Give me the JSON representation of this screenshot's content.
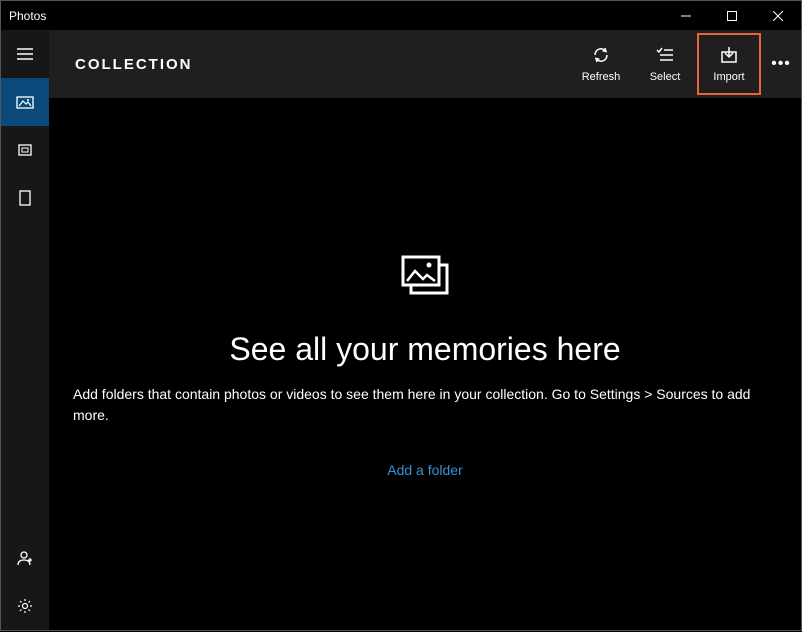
{
  "titlebar": {
    "title": "Photos"
  },
  "header": {
    "title": "COLLECTION",
    "actions": {
      "refresh": "Refresh",
      "select": "Select",
      "import": "Import"
    }
  },
  "empty": {
    "heading": "See all your memories here",
    "description": "Add folders that contain photos or videos to see them here in your collection. Go to Settings > Sources to add more.",
    "add_folder": "Add a folder"
  }
}
